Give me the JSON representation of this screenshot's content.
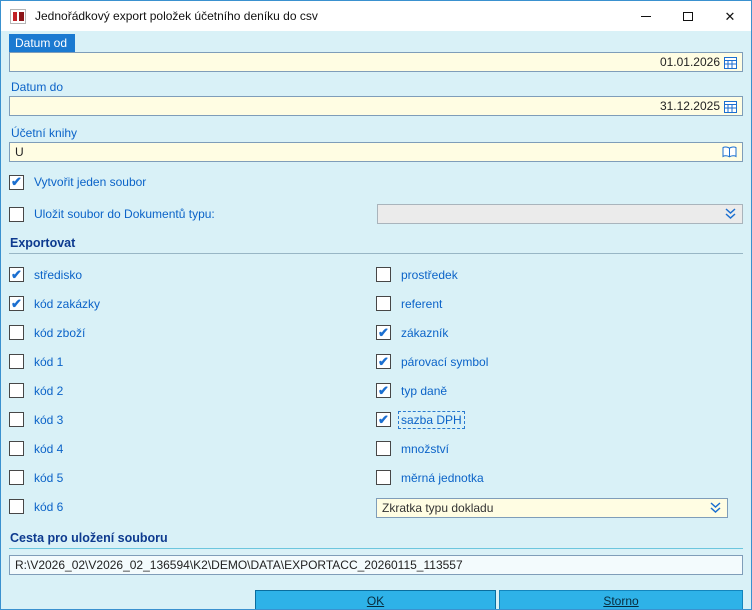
{
  "window": {
    "title": "Jednořádkový export položek účetního deníku do csv"
  },
  "icons": {
    "app": "k2-logo",
    "minimize": "minimize-bar",
    "maximize": "maximize-box",
    "close": "✕",
    "calendar": "calendar-grid",
    "book": "open-book",
    "dropdown": "double-chevron-down"
  },
  "fields": {
    "datum_od": {
      "label": "Datum od",
      "value": "01.01.2026"
    },
    "datum_do": {
      "label": "Datum do",
      "value": "31.12.2025"
    },
    "ucetni_knihy": {
      "label": "Účetní knihy",
      "value": "U"
    }
  },
  "options": {
    "create_one_file": {
      "label": "Vytvořit jeden soubor",
      "checked": true
    },
    "save_to_documents": {
      "label": "Uložit soubor do Dokumentů typu:",
      "checked": false,
      "combo_value": ""
    }
  },
  "export_section": {
    "title": "Exportovat",
    "left": [
      {
        "label": "středisko",
        "checked": true
      },
      {
        "label": "kód zakázky",
        "checked": true
      },
      {
        "label": "kód zboží",
        "checked": false
      },
      {
        "label": "kód 1",
        "checked": false
      },
      {
        "label": "kód 2",
        "checked": false
      },
      {
        "label": "kód 3",
        "checked": false
      },
      {
        "label": "kód 4",
        "checked": false
      },
      {
        "label": "kód 5",
        "checked": false
      },
      {
        "label": "kód 6",
        "checked": false
      }
    ],
    "right": [
      {
        "label": "prostředek",
        "checked": false
      },
      {
        "label": "referent",
        "checked": false
      },
      {
        "label": "zákazník",
        "checked": true
      },
      {
        "label": "párovací symbol",
        "checked": true
      },
      {
        "label": "typ daně",
        "checked": true
      },
      {
        "label": "sazba DPH",
        "checked": true,
        "focused": true
      },
      {
        "label": "množství",
        "checked": false
      },
      {
        "label": "měrná jednotka",
        "checked": false
      }
    ],
    "doc_type_combo_value": "Zkratka typu dokladu"
  },
  "path_section": {
    "title": "Cesta pro uložení souboru",
    "value": "R:\\V2026_02\\V2026_02_136594\\K2\\DEMO\\DATA\\EXPORTACC_20260115_113557"
  },
  "buttons": {
    "ok": "OK",
    "cancel": "Storno"
  }
}
